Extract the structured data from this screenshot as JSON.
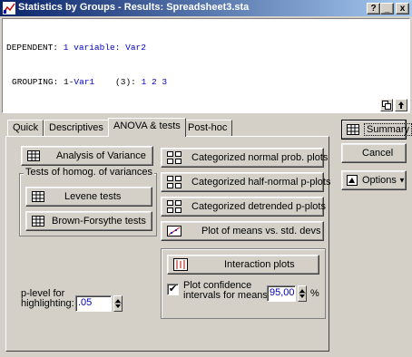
{
  "window": {
    "title": "Statistics by Groups - Results: Spreadsheet3.sta",
    "help_btn": "?",
    "minimize_btn": "_",
    "close_btn": "x"
  },
  "results": {
    "dependent_label": "DEPENDENT:",
    "dependent_value": "1 variable:",
    "dependent_var": "Var2",
    "grouping_label": "GROUPING:",
    "grouping_prefix": "1-",
    "grouping_var": "Var1",
    "grouping_count": "(3):",
    "grouping_levels": "1 2 3"
  },
  "tabs": [
    "Quick",
    "Descriptives",
    "ANOVA & tests",
    "Post-hoc"
  ],
  "buttons": {
    "analysis_of_variance": "Analysis of Variance",
    "levene": "Levene tests",
    "brown_forsythe": "Brown-Forsythe tests",
    "cat_normal": "Categorized normal prob. plots",
    "cat_half_normal": "Categorized half-normal p-plots",
    "cat_detrended": "Categorized detrended  p-plots",
    "means_vs_sd": "Plot of means vs. std. devs",
    "interaction": "Interaction plots",
    "summary": "Summary",
    "cancel": "Cancel",
    "options": "Options"
  },
  "group_homog": {
    "label": "Tests of homog. of variances"
  },
  "plevel": {
    "label_line1": "p-level for",
    "label_line2": "highlighting:",
    "value": ".05"
  },
  "confidence": {
    "label_line1": "Plot confidence",
    "label_line2": "intervals for means:",
    "value": "95,00",
    "unit": "%",
    "checked": "✔"
  }
}
